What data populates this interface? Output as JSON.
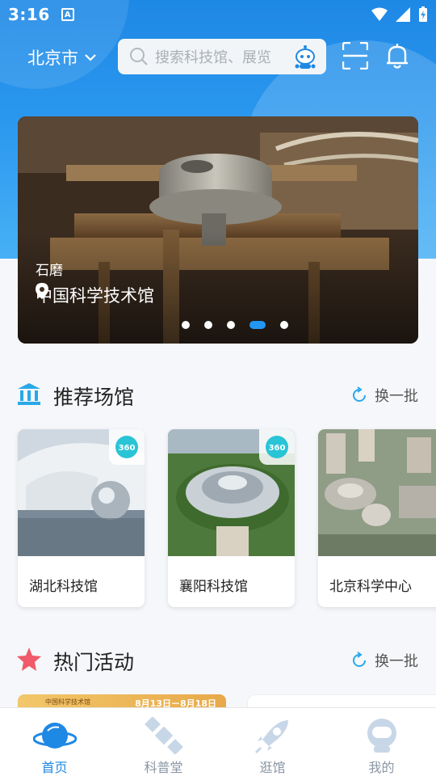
{
  "status_bar": {
    "time": "3:16",
    "notif_letter": "A"
  },
  "header": {
    "city": "北京市",
    "search_placeholder": "搜索科技馆、展览"
  },
  "banner": {
    "title": "石磨",
    "location": "中国科学技术馆",
    "slide_count": 5,
    "active_index": 3
  },
  "recommend": {
    "title": "推荐场馆",
    "refresh_label": "换一批",
    "venues": [
      {
        "name": "湖北科技馆",
        "vr_badge": "360"
      },
      {
        "name": "襄阳科技馆",
        "vr_badge": "360"
      },
      {
        "name": "北京科学中心"
      }
    ]
  },
  "hot": {
    "title": "热门活动",
    "refresh_label": "换一批",
    "first_card_tag": "中国科学技术馆",
    "first_card_date": "8月13日－8月18日"
  },
  "tabbar": {
    "items": [
      {
        "label": "首页",
        "icon": "planet-icon",
        "active": true
      },
      {
        "label": "科普堂",
        "icon": "satellite-icon",
        "active": false
      },
      {
        "label": "逛馆",
        "icon": "rocket-icon",
        "active": false
      },
      {
        "label": "我的",
        "icon": "astronaut-icon",
        "active": false
      }
    ]
  },
  "colors": {
    "primary": "#1e88e5",
    "header_bg": "#2a97ee",
    "inactive_tab": "#8a96a3"
  }
}
